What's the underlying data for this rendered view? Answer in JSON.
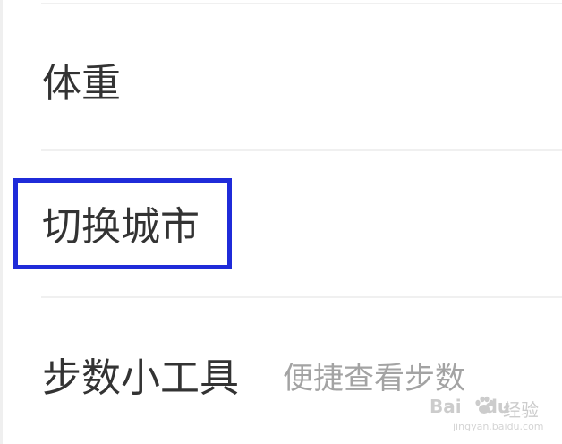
{
  "menu": {
    "items": [
      {
        "label": "体重"
      },
      {
        "label": "切换城市"
      },
      {
        "label": "步数小工具",
        "sublabel": "便捷查看步数"
      }
    ]
  },
  "highlight_color": "#1f2bd9",
  "watermark": {
    "brand": "Bai",
    "brand_suffix": "du",
    "jingyan": "经验",
    "url": "jingyan.baidu.com"
  }
}
